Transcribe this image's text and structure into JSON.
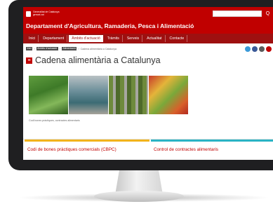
{
  "header": {
    "gov_name_line1": "Generalitat de Catalunya",
    "gov_name_line2": "gencat.cat",
    "department": "Departament d'Agricultura, Ramaderia, Pesca i Alimentació",
    "search_placeholder": "",
    "search_icon": "Q"
  },
  "nav": {
    "items": [
      {
        "label": "Inici"
      },
      {
        "label": "Departament"
      },
      {
        "label": "Àmbits d'actuació"
      },
      {
        "label": "Tràmits"
      },
      {
        "label": "Serveis"
      },
      {
        "label": "Actualitat"
      },
      {
        "label": "Contacte"
      }
    ]
  },
  "breadcrumb": {
    "items": [
      "Inici",
      "Àmbits d'actuació",
      "Alimentació"
    ],
    "current": "Cadena alimentària a Catalunya"
  },
  "page": {
    "title": "Cadena alimentària a Catalunya",
    "title_icon": "list-icon",
    "caption": "Codi bones pràctiques, contractes alimentaris"
  },
  "cards": [
    {
      "label": "Codi de bones pràctiques comercials (CBPC)",
      "color": "#f2b31b"
    },
    {
      "label": "Control de contractes alimentaris",
      "color": "#2ab3c4"
    }
  ],
  "colors": {
    "brand": "#c00000",
    "nav": "#9e1010"
  }
}
